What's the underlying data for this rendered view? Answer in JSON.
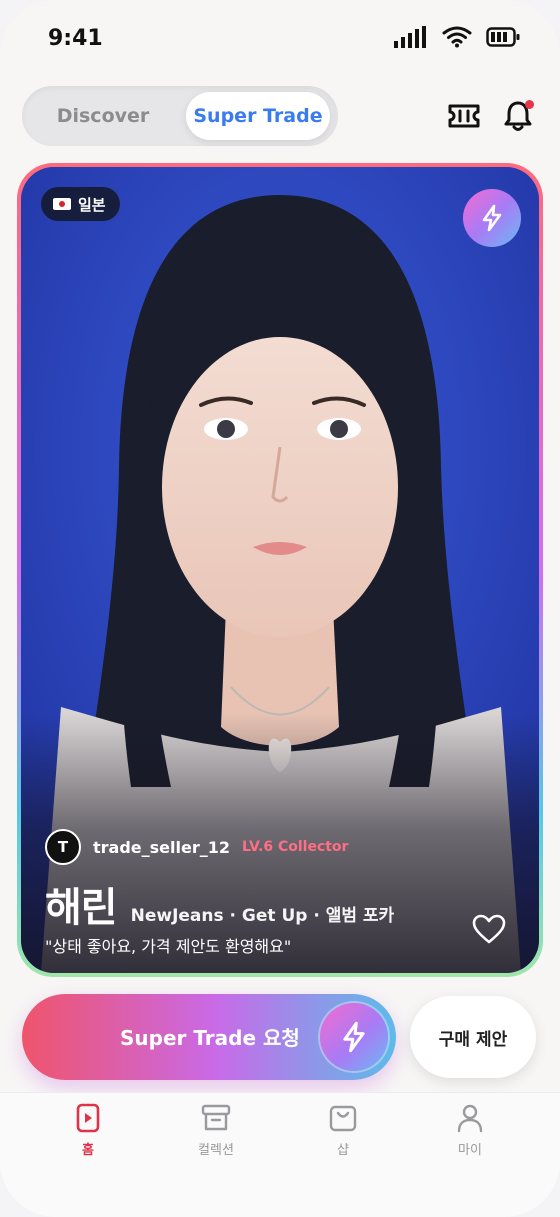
{
  "status": {
    "time": "9:41"
  },
  "tabs": {
    "discover": "Discover",
    "super_trade": "Super Trade",
    "active": "super_trade"
  },
  "card": {
    "country": "일본",
    "seller": {
      "avatar_initial": "T",
      "name": "trade_seller_12",
      "level": "LV.6 Collector"
    },
    "title": "해린",
    "subtitle": "NewJeans · Get Up · 앨범 포카",
    "comment": "\"상태 좋아요, 가격 제안도 환영해요\"",
    "liked": false
  },
  "actions": {
    "super_trade": "Super Trade 요청",
    "buy_offer": "구매 제안"
  },
  "nav": [
    {
      "label": "홈",
      "icon": "home-play-icon",
      "active": true
    },
    {
      "label": "컬렉션",
      "icon": "archive-box-icon",
      "active": false
    },
    {
      "label": "샵",
      "icon": "shopping-bag-icon",
      "active": false
    },
    {
      "label": "마이",
      "icon": "person-icon",
      "active": false
    }
  ],
  "colors": {
    "accent_blue": "#3a7cf0",
    "accent_red": "#e0334a",
    "level_pink": "#ff6e84",
    "card_background_blue": "#2a40b5"
  }
}
